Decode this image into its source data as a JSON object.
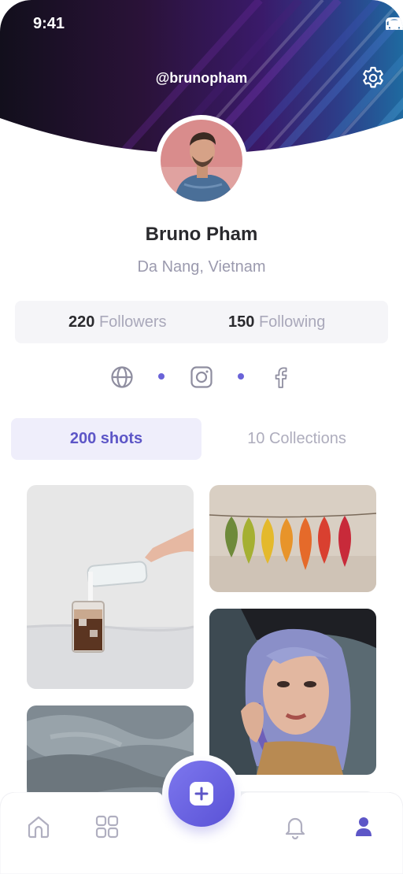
{
  "status": {
    "time": "9:41"
  },
  "header": {
    "username": "@brunopham"
  },
  "profile": {
    "name": "Bruno Pham",
    "location": "Da Nang, Vietnam"
  },
  "stats": {
    "followers_count": "220",
    "followers_label": "Followers",
    "following_count": "150",
    "following_label": "Following"
  },
  "socials": [
    "globe-icon",
    "instagram-icon",
    "facebook-icon"
  ],
  "tabs": {
    "shots": "200 shots",
    "collections": "10 Collections"
  },
  "shots": [
    "iced-coffee-pour",
    "autumn-leaves",
    "woman-purple-hair",
    "cloudy-sky"
  ],
  "bottom_nav": [
    "home-icon",
    "grid-icon",
    "add-icon",
    "bell-icon",
    "profile-icon"
  ],
  "colors": {
    "accent": "#5d56c7",
    "fab": "#6a63e0",
    "muted": "#9b9aae"
  }
}
